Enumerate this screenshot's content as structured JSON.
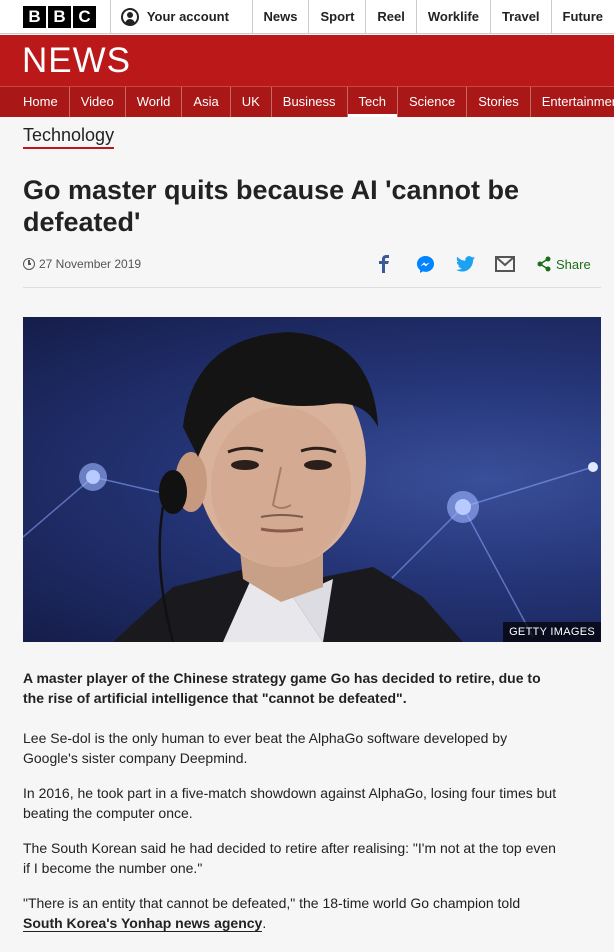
{
  "topbar": {
    "logo_letters": [
      "B",
      "B",
      "C"
    ],
    "account_label": "Your account",
    "nav": [
      "News",
      "Sport",
      "Reel",
      "Worklife",
      "Travel",
      "Future"
    ]
  },
  "banner": {
    "title": "NEWS"
  },
  "section_nav": {
    "items": [
      "Home",
      "Video",
      "World",
      "Asia",
      "UK",
      "Business",
      "Tech",
      "Science",
      "Stories",
      "Entertainment & Arts"
    ],
    "active": "Tech"
  },
  "article": {
    "section": "Technology",
    "headline": "Go master quits because AI 'cannot be defeated'",
    "date": "27 November 2019",
    "share_label": "Share",
    "image_credit": "GETTY IMAGES",
    "lede": "A master player of the Chinese strategy game Go has decided to retire, due to the rise of artificial intelligence that \"cannot be defeated\".",
    "paragraphs": [
      "Lee Se-dol is the only human to ever beat the AlphaGo software developed by Google's sister company Deepmind.",
      "In 2016, he took part in a five-match showdown against AlphaGo, losing four times but beating the computer once.",
      "The South Korean said he had decided to retire after realising: \"I'm not at the top even if I become the number one.\""
    ],
    "last_paragraph_text": "\"There is an entity that cannot be defeated,\" the 18-time world Go champion told ",
    "last_paragraph_link": "South Korea's Yonhap news agency",
    "last_paragraph_end": "."
  },
  "colors": {
    "brand_red": "#bb1919",
    "nav_red": "#a91717",
    "share_green": "#1a6e1a",
    "facebook_blue": "#3b5998",
    "twitter_blue": "#1da1f2"
  },
  "icons": [
    "account-icon",
    "clock-icon",
    "facebook-icon",
    "messenger-icon",
    "twitter-icon",
    "email-icon",
    "share-icon"
  ]
}
